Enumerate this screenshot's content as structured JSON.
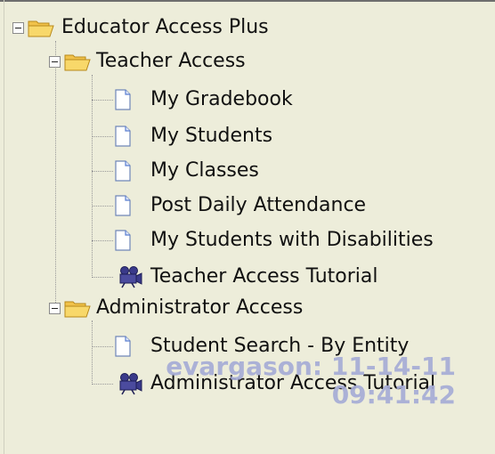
{
  "tree": {
    "root": {
      "label": "Educator Access Plus",
      "icon": "open-folder-icon",
      "expanded": true
    },
    "teacher_access": {
      "label": "Teacher Access",
      "icon": "open-folder-icon",
      "expanded": true,
      "items": [
        {
          "label": "My Gradebook",
          "icon": "document-icon"
        },
        {
          "label": "My Students",
          "icon": "document-icon"
        },
        {
          "label": "My Classes",
          "icon": "document-icon"
        },
        {
          "label": "Post Daily Attendance",
          "icon": "document-icon"
        },
        {
          "label": "My Students with Disabilities",
          "icon": "document-icon"
        },
        {
          "label": "Teacher Access Tutorial",
          "icon": "video-camera-icon"
        }
      ]
    },
    "administrator_access": {
      "label": "Administrator Access",
      "icon": "open-folder-icon",
      "expanded": true,
      "items": [
        {
          "label": "Student Search - By Entity",
          "icon": "document-icon"
        },
        {
          "label": "Administrator Access Tutorial",
          "icon": "video-camera-icon"
        }
      ]
    }
  },
  "watermark": {
    "line1": "evargason: 11-14-11",
    "line2": "09:41:42"
  },
  "colors": {
    "background": "#ededda",
    "folder": "#f5c94a",
    "document_fold": "#5b7fd0",
    "camera": "#3a3a8a",
    "watermark": "#a6acd6"
  }
}
